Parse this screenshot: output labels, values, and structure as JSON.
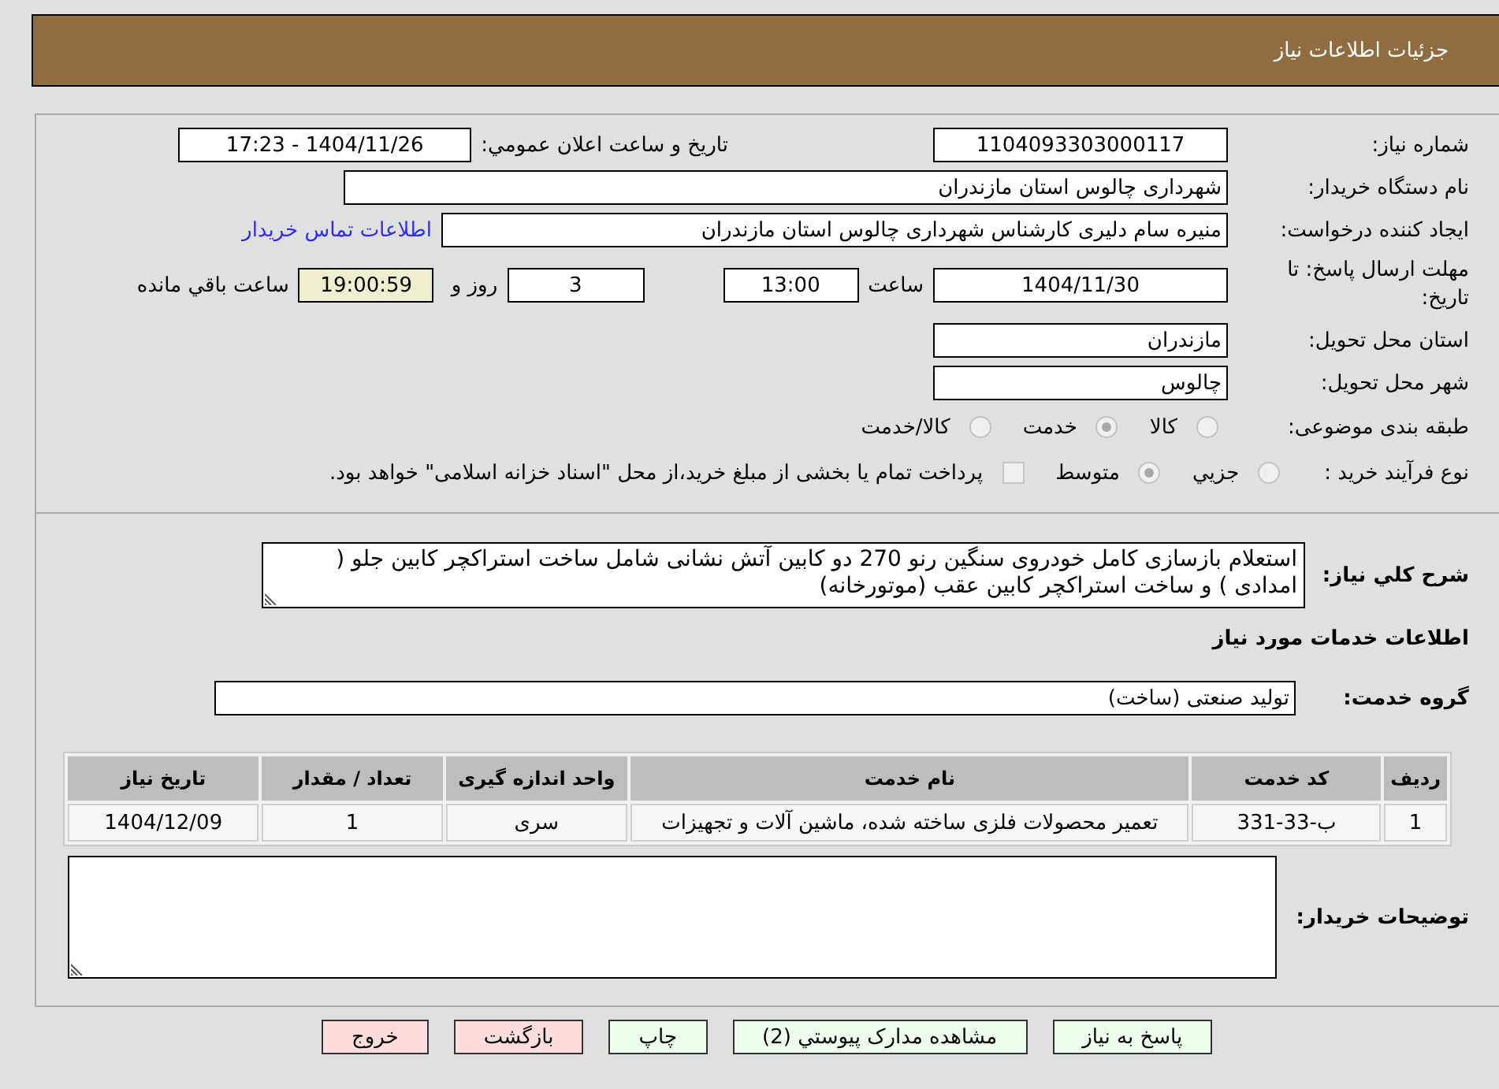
{
  "header": {
    "title": "جزئیات اطلاعات نیاز"
  },
  "details": {
    "need_number": {
      "label": "شماره نیاز:",
      "value": "1104093303000117"
    },
    "announce": {
      "label": "تاریخ و ساعت اعلان عمومي:",
      "value": "1404/11/26 - 17:23"
    },
    "buyer": {
      "label": "نام دستگاه خریدار:",
      "value": "شهرداری چالوس استان مازندران"
    },
    "creator": {
      "label": "ایجاد کننده درخواست:",
      "value": "منیره سام دلیری کارشناس شهرداری چالوس استان مازندران",
      "link": "اطلاعات تماس خریدار"
    },
    "deadline": {
      "label": "مهلت ارسال پاسخ: تا تاریخ:",
      "date": "1404/11/30",
      "time_label": "ساعت",
      "time": "13:00",
      "days": "3",
      "days_label": "روز و",
      "remaining": "19:00:59",
      "remaining_label": "ساعت باقي مانده"
    },
    "province": {
      "label": "استان محل تحویل:",
      "value": "مازندران"
    },
    "city": {
      "label": "شهر محل تحویل:",
      "value": "چالوس"
    },
    "category": {
      "label": "طبقه بندی موضوعی:",
      "options": [
        {
          "label": "کالا",
          "selected": false,
          "disabled": true
        },
        {
          "label": "خدمت",
          "selected": true,
          "disabled": true
        },
        {
          "label": "کالا/خدمت",
          "selected": false,
          "disabled": true
        }
      ]
    },
    "process": {
      "label": "نوع فرآیند خرید :",
      "options": [
        {
          "label": "جزیي",
          "selected": false,
          "disabled": true
        },
        {
          "label": "متوسط",
          "selected": true,
          "disabled": true
        }
      ],
      "treasury": {
        "label": "پرداخت تمام یا بخشی از مبلغ خرید،از محل \"اسناد خزانه اسلامی\" خواهد بود.",
        "checked": false,
        "disabled": true
      }
    }
  },
  "description": {
    "label": "شرح کلي نیاز:",
    "value": "استعلام بازسازی کامل خودروی سنگین رنو 270 دو کابین آتش نشانی شامل ساخت استراکچر کابین جلو ( امدادی ) و ساخت استراکچر کابین عقب (موتورخانه)"
  },
  "services": {
    "title": "اطلاعات خدمات مورد نیاز",
    "group": {
      "label": "گروه خدمت:",
      "value": "تولید صنعتی (ساخت)"
    },
    "table": {
      "columns": [
        "ردیف",
        "کد خدمت",
        "نام خدمت",
        "واحد اندازه گیری",
        "تعداد / مقدار",
        "تاریخ نیاز"
      ],
      "rows": [
        [
          "1",
          "ب-33-331",
          "تعمیر محصولات فلزی ساخته شده، ماشین آلات و تجهیزات",
          "سری",
          "1",
          "1404/12/09"
        ]
      ]
    }
  },
  "notes": {
    "label": "توضیحات خریدار:"
  },
  "buttons": [
    {
      "label": "پاسخ به نیاز",
      "kind": "action"
    },
    {
      "label": "مشاهده مدارک پیوستي (2)",
      "kind": "action"
    },
    {
      "label": "چاپ",
      "kind": "action"
    },
    {
      "label": "بازگشت",
      "kind": "leave"
    },
    {
      "label": "خروج",
      "kind": "leave"
    }
  ]
}
